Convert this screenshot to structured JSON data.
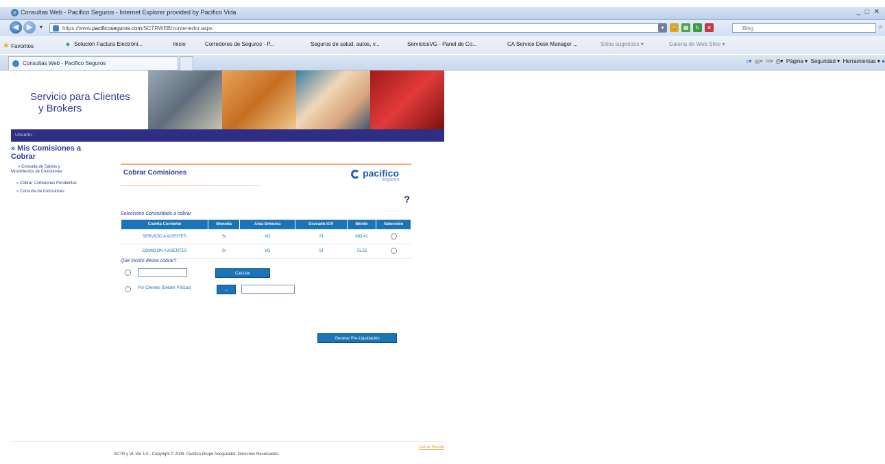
{
  "window": {
    "title": "Consultas Web - Pacifico Seguros - Internet Explorer provided by Pacifico Vida",
    "controls": "_ □ ✕"
  },
  "address": {
    "protocol": "https://www.",
    "host": "pacificoseguros.com",
    "path": "/SCTRWEB/contenedor.aspx",
    "search_placeholder": "Bing"
  },
  "favorites": {
    "label": "Favoritos",
    "items": [
      "Solución Factura Electróni...",
      "Inicio",
      "Corredores de Seguros - P...",
      "Seguros de salud, autos, v...",
      "ServiciosVG - Panel de Co...",
      "CA Service Desk Manager ...",
      "Sitios sugeridos ▾",
      "Galería de Web Slice ▾"
    ]
  },
  "tab": {
    "label": "Consultas Web - Pacifico Seguros"
  },
  "commandbar": {
    "pagina": "Página ▾",
    "seguridad": "Seguridad ▾",
    "herramientas": "Herramientas ▾"
  },
  "page": {
    "brand_line1": "Servicio para Clientes",
    "brand_line2": "y Brokers",
    "user_label": "Usuario :",
    "menu": {
      "title_line1": "» Mis Comisiones a",
      "title_line2": "Cobrar",
      "items": [
        "» Consulta de Saldos y",
        "Movimientos de Comisiones",
        "» Cobrar Comisiones Pendientes",
        "» Consulta de Comisiones"
      ]
    },
    "panel": {
      "title": "Cobrar Comisiones",
      "logo_word": "pacifico",
      "logo_sub": "seguros",
      "help": "?",
      "select_title": "Seleccione Consolidado a cobrar",
      "columns": [
        "Cuenta Corriente",
        "Moneda",
        "Area Emisora",
        "Gravado IGV",
        "Monto",
        "Selección"
      ],
      "rows": [
        [
          "SERVICIO A AGENTES",
          "S/",
          "VG",
          "SI",
          "683.41"
        ],
        [
          "COMISION A AGENTES",
          "S/",
          "VG",
          "SI",
          "71.25"
        ]
      ],
      "question": "Que monto desea cobrar?",
      "calc_button": "Calcular",
      "by_client_label": "Por Clientes (Detalle Pólizas)",
      "dots_button": "...",
      "generate_button": "Generar Pre-Liquidación"
    },
    "footer": "SCTR y VL Ver 1.0 - Copyright © 2006. Pacifico Grupo Asegurador. Derechos Reservados.",
    "logout": "Cerrar Sesión"
  }
}
